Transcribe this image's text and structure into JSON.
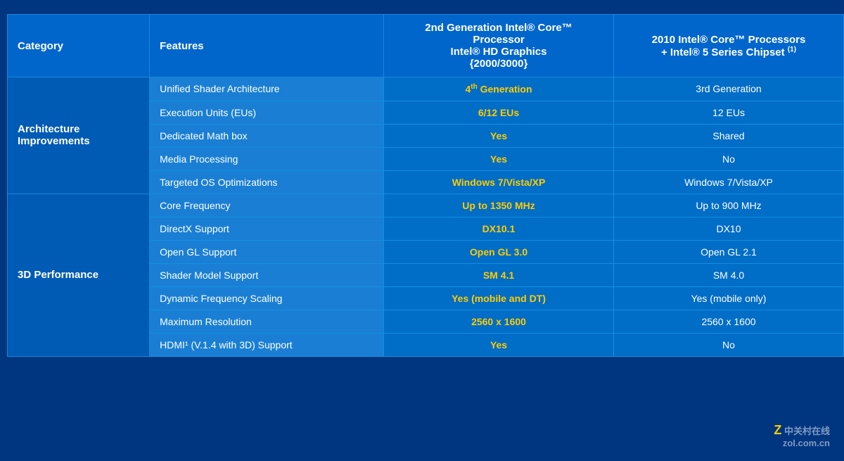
{
  "header": {
    "col1": "Category",
    "col2": "Features",
    "col3_line1": "2nd Generation Intel® Core™",
    "col3_line2": "Processor",
    "col3_line3": "Intel® HD Graphics",
    "col3_line4": "{2000/3000}",
    "col4_line1": "2010 Intel® Core™ Processors",
    "col4_line2": "+ Intel® 5 Series Chipset",
    "col4_sup": "(1)"
  },
  "sections": [
    {
      "category": "Architecture\nImprovements",
      "rowspan": 5,
      "rows": [
        {
          "feature": "Unified Shader Architecture",
          "val_new": "4th Generation",
          "val_new_sup": "th",
          "val_old": "3rd Generation"
        },
        {
          "feature": "Execution Units (EUs)",
          "val_new": "6/12 EUs",
          "val_old": "12 EUs"
        },
        {
          "feature": "Dedicated  Math box",
          "val_new": "Yes",
          "val_old": "Shared"
        },
        {
          "feature": "Media Processing",
          "val_new": "Yes",
          "val_old": "No"
        },
        {
          "feature": "Targeted OS Optimizations",
          "val_new": "Windows 7/Vista/XP",
          "val_old": "Windows 7/Vista/XP"
        }
      ]
    },
    {
      "category": "3D Performance",
      "rowspan": 7,
      "rows": [
        {
          "feature": "Core Frequency",
          "val_new": "Up to 1350 MHz",
          "val_old": "Up to 900 MHz"
        },
        {
          "feature": "DirectX Support",
          "val_new": "DX10.1",
          "val_old": "DX10"
        },
        {
          "feature": "Open GL Support",
          "val_new": "Open GL 3.0",
          "val_old": "Open GL 2.1"
        },
        {
          "feature": "Shader Model Support",
          "val_new": "SM 4.1",
          "val_old": "SM 4.0"
        },
        {
          "feature": "Dynamic Frequency Scaling",
          "val_new": "Yes (mobile and DT)",
          "val_old": "Yes (mobile only)"
        },
        {
          "feature": "Maximum Resolution",
          "val_new": "2560 x 1600",
          "val_old": "2560 x 1600"
        },
        {
          "feature": "HDMI¹ (V.1.4 with 3D) Support",
          "val_new": "Yes",
          "val_old": "No"
        }
      ]
    }
  ],
  "watermark": "Z 中关村在线\nzol.com.cn"
}
